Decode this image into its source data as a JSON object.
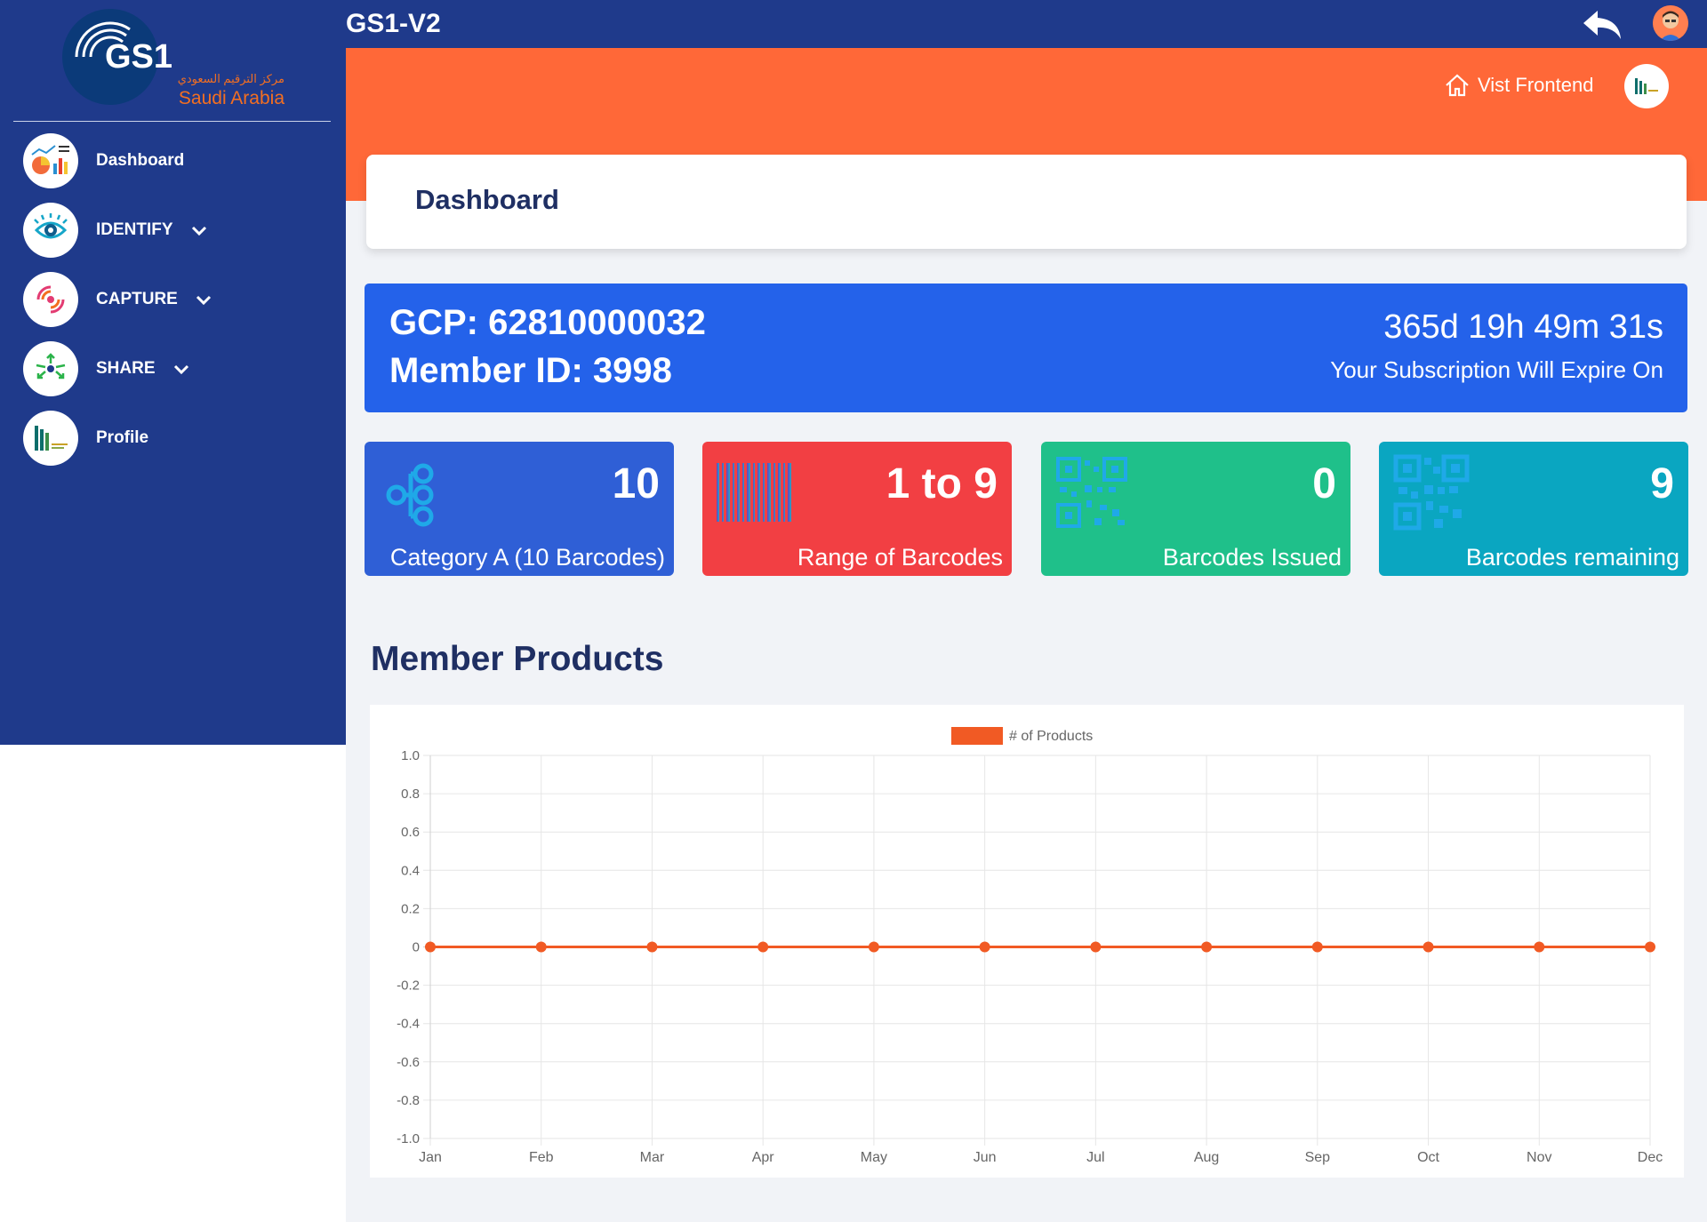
{
  "logo": {
    "mark": "GS1",
    "arabic": "مركز الترقيم السعودي",
    "country": "Saudi Arabia"
  },
  "sidebar": {
    "items": [
      {
        "label": "Dashboard",
        "icon": "dashboard-icon",
        "expandable": false
      },
      {
        "label": "IDENTIFY",
        "icon": "identify-eye-icon",
        "expandable": true
      },
      {
        "label": "CAPTURE",
        "icon": "capture-target-icon",
        "expandable": true
      },
      {
        "label": "SHARE",
        "icon": "share-arrows-icon",
        "expandable": true
      },
      {
        "label": "Profile",
        "icon": "profile-brand-icon",
        "expandable": false
      }
    ]
  },
  "header": {
    "title": "GS1-V2",
    "back_icon": "reply-icon",
    "avatar_icon": "user-avatar-icon"
  },
  "top_band": {
    "visit_label": "Vist Frontend",
    "visit_icon": "home-icon"
  },
  "page": {
    "title": "Dashboard"
  },
  "subscription": {
    "gcp": "GCP: 62810000032",
    "member_id": "Member ID: 3998",
    "countdown": "365d 19h 49m 31s",
    "expire_label": "Your Subscription Will Expire On"
  },
  "stats": [
    {
      "value": "10",
      "label": "Category A (10 Barcodes)",
      "icon": "category-nodes-icon",
      "color": "#2f5fd6"
    },
    {
      "value": "1 to 9",
      "label": "Range of Barcodes",
      "icon": "barcode-icon",
      "color": "#f23f43"
    },
    {
      "value": "0",
      "label": "Barcodes Issued",
      "icon": "qr-code-icon",
      "color": "#1fc08a"
    },
    {
      "value": "9",
      "label": "Barcodes remaining",
      "icon": "qr-code-icon",
      "color": "#0aa6c1"
    }
  ],
  "section": {
    "title": "Member Products"
  },
  "colors": {
    "navy": "#1f3a8b",
    "orange": "#ff6838",
    "blue": "#2462ea",
    "series": "#f15a24"
  },
  "chart_data": {
    "type": "line",
    "categories": [
      "Jan",
      "Feb",
      "Mar",
      "Apr",
      "May",
      "Jun",
      "Jul",
      "Aug",
      "Sep",
      "Oct",
      "Nov",
      "Dec"
    ],
    "series": [
      {
        "name": "# of Products",
        "values": [
          0,
          0,
          0,
          0,
          0,
          0,
          0,
          0,
          0,
          0,
          0,
          0
        ]
      }
    ],
    "yticks": [
      "1.0",
      "0.8",
      "0.6",
      "0.4",
      "0.2",
      "0",
      "-0.2",
      "-0.4",
      "-0.6",
      "-0.8",
      "-1.0"
    ],
    "ylim": [
      -1,
      1
    ],
    "grid": true,
    "legend": "top-center"
  }
}
